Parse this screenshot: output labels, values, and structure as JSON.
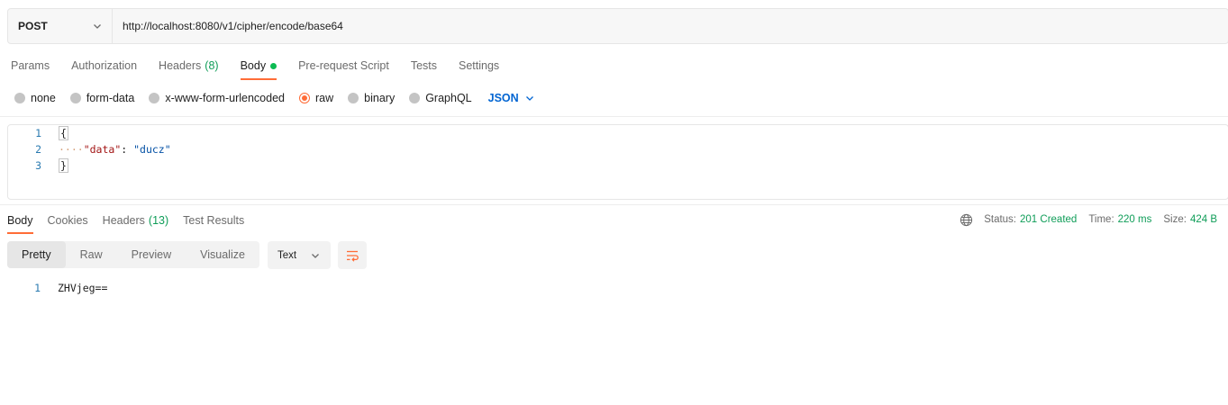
{
  "request": {
    "method": "POST",
    "url": "http://localhost:8080/v1/cipher/encode/base64"
  },
  "request_tabs": [
    {
      "label": "Params"
    },
    {
      "label": "Authorization"
    },
    {
      "label": "Headers",
      "count": "(8)"
    },
    {
      "label": "Body",
      "active": true,
      "indicator": "green-dot"
    },
    {
      "label": "Pre-request Script"
    },
    {
      "label": "Tests"
    },
    {
      "label": "Settings"
    }
  ],
  "body_types": {
    "options": [
      "none",
      "form-data",
      "x-www-form-urlencoded",
      "raw",
      "binary",
      "GraphQL"
    ],
    "selected": "raw",
    "language": "JSON"
  },
  "editor": {
    "lines": [
      {
        "num": "1",
        "text": "{"
      },
      {
        "num": "2",
        "key": "\"data\"",
        "sep": ": ",
        "value": "\"ducz\""
      },
      {
        "num": "3",
        "text": "}"
      }
    ]
  },
  "response_tabs": [
    {
      "label": "Body",
      "active": true
    },
    {
      "label": "Cookies"
    },
    {
      "label": "Headers",
      "count": "(13)"
    },
    {
      "label": "Test Results"
    }
  ],
  "status": {
    "status_label": "Status:",
    "status_value": "201 Created",
    "time_label": "Time:",
    "time_value": "220 ms",
    "size_label": "Size:",
    "size_value": "424 B"
  },
  "view_modes": [
    "Pretty",
    "Raw",
    "Preview",
    "Visualize"
  ],
  "active_view": "Pretty",
  "format": "Text",
  "response_body": {
    "lines": [
      {
        "num": "1",
        "text": "ZHVjeg=="
      }
    ]
  },
  "colors": {
    "accent": "#ff6c37",
    "success": "#0f9d58",
    "link": "#0265d2"
  },
  "icons": [
    "chevron-down-icon",
    "globe-icon",
    "wrap-lines-icon"
  ]
}
